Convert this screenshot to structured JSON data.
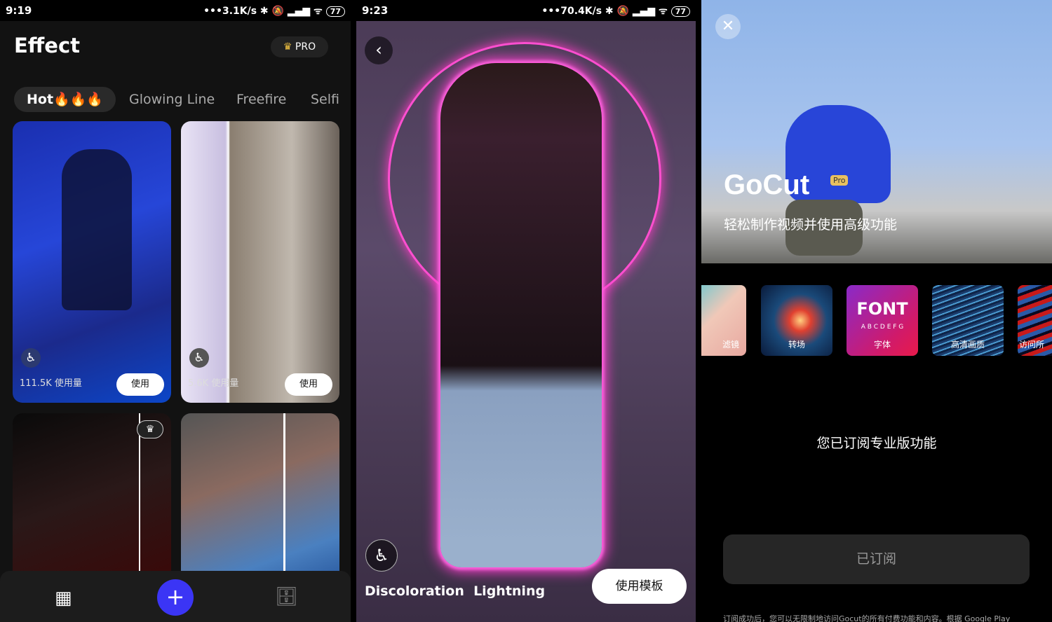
{
  "left": {
    "status": {
      "time": "9:19",
      "net": "•••3.1K/s",
      "battery": "77"
    },
    "title": "Effect",
    "pro_label": "PRO",
    "tabs": [
      {
        "label": "Hot"
      },
      {
        "label": "Glowing Line"
      },
      {
        "label": "Freefire"
      },
      {
        "label": "Selfi"
      }
    ],
    "cards": [
      {
        "count": "111.5K 使用量",
        "use": "使用"
      },
      {
        "count": "5.6K 使用量",
        "use": "使用"
      }
    ],
    "nav": [
      "home-grid",
      "add",
      "inbox"
    ],
    "accent": "#3b35f5"
  },
  "middle": {
    "status": {
      "time": "9:23",
      "net": "•••70.4K/s",
      "battery": "77"
    },
    "effect_name": "Discoloration  Lightning",
    "use_template": "使用模板"
  },
  "right": {
    "logo": "GoCut",
    "logo_badge": "Pro",
    "subtitle": "轻松制作视频并使用高级功能",
    "features": [
      {
        "label": "滤镜"
      },
      {
        "label": "转场"
      },
      {
        "label": "字体",
        "title": "FONT",
        "sub": "A B C D E F G"
      },
      {
        "label": "高清画质"
      },
      {
        "label": "访问所"
      }
    ],
    "subscribed_text": "您已订阅专业版功能",
    "button": "已订阅",
    "footer": "订阅成功后，您可以无限制地访问Gocut的所有付费功能和内容。根据 Google Play"
  }
}
